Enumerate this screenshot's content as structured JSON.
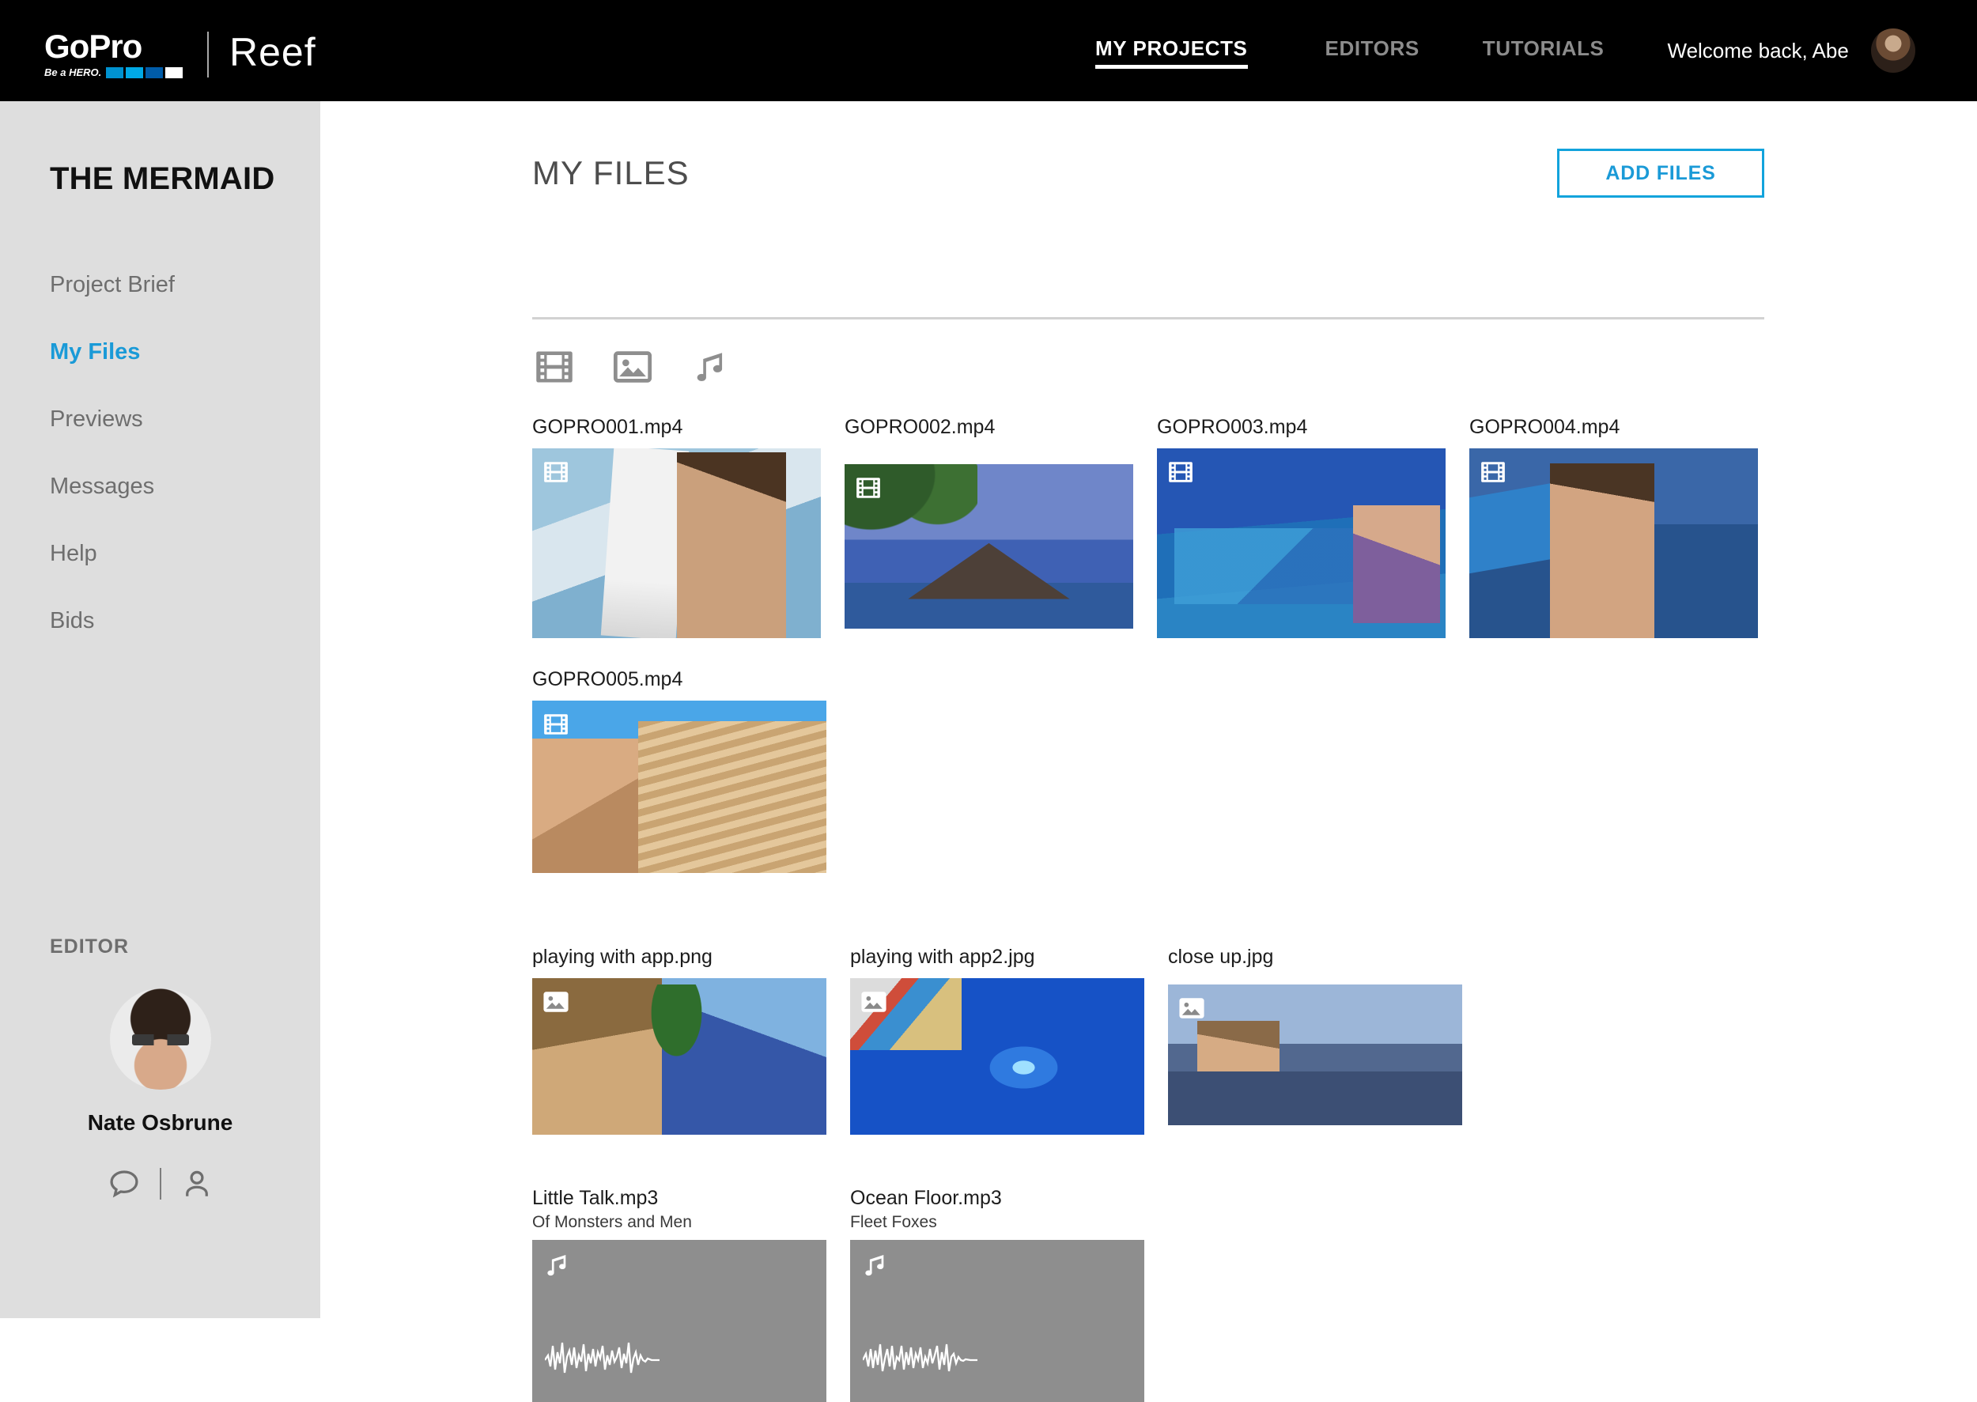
{
  "topbar": {
    "brand_name": "GoPro",
    "brand_tagline": "Be a HERO.",
    "product_name": "Reef",
    "nav": [
      {
        "label": "MY PROJECTS",
        "active": true
      },
      {
        "label": "EDITORS",
        "active": false
      },
      {
        "label": "TUTORIALS",
        "active": false
      }
    ],
    "welcome_text": "Welcome back, Abe",
    "avatar_name": "user-avatar"
  },
  "sidebar": {
    "project_title": "THE MERMAID",
    "items": [
      {
        "label": "Project Brief",
        "active": false
      },
      {
        "label": "My Files",
        "active": true
      },
      {
        "label": "Previews",
        "active": false
      },
      {
        "label": "Messages",
        "active": false
      },
      {
        "label": "Help",
        "active": false
      },
      {
        "label": "Bids",
        "active": false
      }
    ],
    "editor_label": "EDITOR",
    "editor_name": "Nate Osbrune",
    "editor_actions": [
      "message-icon",
      "profile-icon"
    ]
  },
  "main": {
    "title": "MY FILES",
    "add_files_label": "ADD FILES",
    "filters": [
      {
        "name": "video-filter-icon",
        "type": "video"
      },
      {
        "name": "image-filter-icon",
        "type": "image"
      },
      {
        "name": "audio-filter-icon",
        "type": "audio"
      }
    ],
    "files": {
      "videos_row1": [
        {
          "name": "GOPRO001.mp4",
          "type": "video"
        },
        {
          "name": "GOPRO002.mp4",
          "type": "video"
        },
        {
          "name": "GOPRO003.mp4",
          "type": "video"
        },
        {
          "name": "GOPRO004.mp4",
          "type": "video"
        }
      ],
      "videos_row2": [
        {
          "name": "GOPRO005.mp4",
          "type": "video"
        }
      ],
      "images": [
        {
          "name": "playing with app.png",
          "type": "image"
        },
        {
          "name": "playing with app2.jpg",
          "type": "image"
        },
        {
          "name": "close up.jpg",
          "type": "image"
        }
      ],
      "audio": [
        {
          "name": "Little Talk.mp3",
          "artist": "Of Monsters and Men",
          "type": "audio"
        },
        {
          "name": "Ocean Floor.mp3",
          "artist": "Fleet Foxes",
          "type": "audio"
        }
      ]
    }
  },
  "colors": {
    "accent_blue": "#1a9ad7",
    "button_border": "#12a3dc",
    "header_bg": "#000000",
    "sidebar_bg": "#dedede",
    "audio_card_bg": "#8e8e8e"
  }
}
